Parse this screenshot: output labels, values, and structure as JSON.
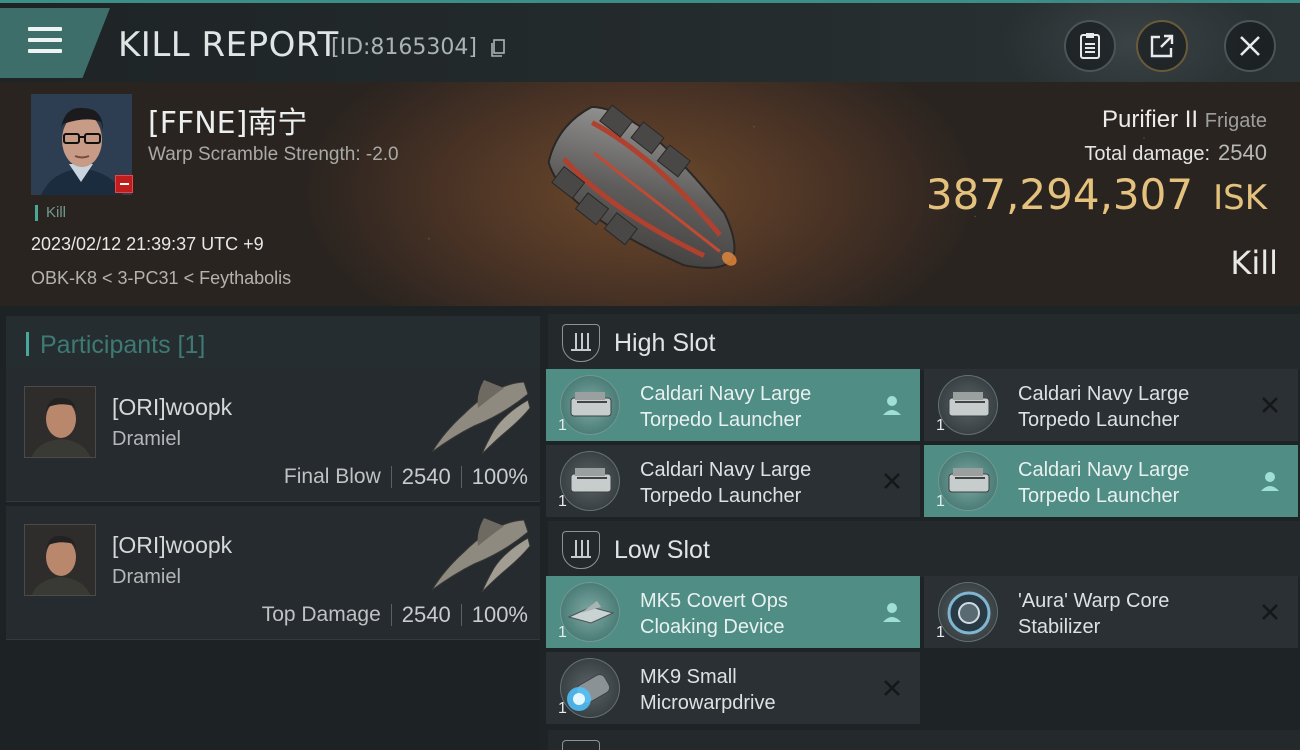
{
  "header": {
    "title": "KILL REPORT",
    "report_id": "[ID:8165304]",
    "menu_icon": "hamburger-icon",
    "buttons": [
      "clipboard-icon",
      "share-icon",
      "close-icon"
    ]
  },
  "victim": {
    "name": "[FFNE]南宁",
    "warp_scramble": "Warp Scramble Strength: -2.0",
    "tag": "Kill",
    "datetime": "2023/02/12 21:39:37 UTC +9",
    "location": "OBK-K8 < 3-PC31 < Feythabolis",
    "ship_name": "Purifier II",
    "ship_class": "Frigate",
    "total_damage_label": "Total damage:",
    "total_damage": "2540",
    "isk_value": "387,294,307",
    "isk_unit": "ISK",
    "result": "Kill"
  },
  "participants": {
    "label": "Participants [1]",
    "cards": [
      {
        "name": "[ORI]woopk",
        "ship": "Dramiel",
        "role": "Final Blow",
        "damage": "2540",
        "percent": "100%"
      },
      {
        "name": "[ORI]woopk",
        "ship": "Dramiel",
        "role": "Top Damage",
        "damage": "2540",
        "percent": "100%"
      }
    ]
  },
  "fitting": {
    "high_slot_label": "High Slot",
    "low_slot_label": "Low Slot",
    "high": [
      {
        "name": "Caldari Navy Large Torpedo Launcher",
        "qty": "1",
        "state": "fitted"
      },
      {
        "name": "Caldari Navy Large Torpedo Launcher",
        "qty": "1",
        "state": "destroyed"
      },
      {
        "name": "Caldari Navy Large Torpedo Launcher",
        "qty": "1",
        "state": "destroyed"
      },
      {
        "name": "Caldari Navy Large Torpedo Launcher",
        "qty": "1",
        "state": "fitted"
      }
    ],
    "low": [
      {
        "name": "MK5 Covert Ops Cloaking Device",
        "qty": "1",
        "state": "fitted"
      },
      {
        "name": "'Aura' Warp Core Stabilizer",
        "qty": "1",
        "state": "destroyed"
      },
      {
        "name": "MK9 Small Microwarpdrive",
        "qty": "1",
        "state": "destroyed"
      }
    ]
  },
  "colors": {
    "accent": "#4aa89a",
    "isk": "#e4c27e",
    "fitted": "#4f8d85",
    "destroyed_bg": "#2a3033"
  }
}
